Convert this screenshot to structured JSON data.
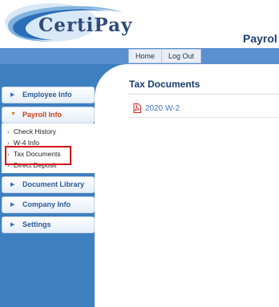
{
  "header": {
    "logo_text": "CertiPay",
    "page_heading": "Payrol"
  },
  "topnav": {
    "home_label": "Home",
    "logout_label": "Log Out"
  },
  "sidebar": {
    "items": [
      {
        "label": "Employee Info"
      },
      {
        "label": "Payroll Info"
      },
      {
        "label": "Document Library"
      },
      {
        "label": "Company Info"
      },
      {
        "label": "Settings"
      }
    ],
    "payroll_submenu": [
      {
        "label": "Check History"
      },
      {
        "label": "W-4 Info"
      },
      {
        "label": "Tax Documents"
      },
      {
        "label": "Direct Deposit"
      }
    ]
  },
  "main": {
    "title": "Tax Documents",
    "documents": [
      {
        "label": "2020 W-2",
        "icon": "pdf-icon"
      }
    ]
  },
  "colors": {
    "brand_blue": "#3e7fc0",
    "active_orange": "#c9401c",
    "highlight_red": "#d4101a",
    "link_blue": "#3c78c0"
  }
}
